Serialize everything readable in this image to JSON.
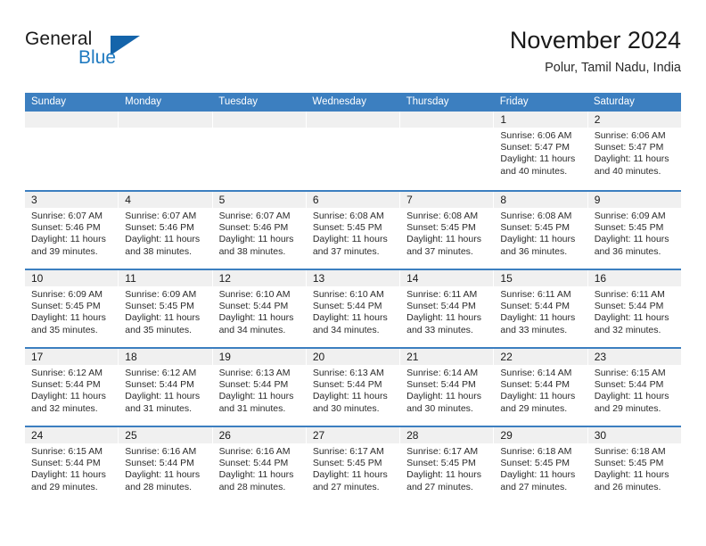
{
  "brand": {
    "general": "General",
    "blue": "Blue",
    "triangle_color": "#1464aa"
  },
  "header": {
    "title": "November 2024",
    "subtitle": "Polur, Tamil Nadu, India"
  },
  "theme": {
    "header_blue": "#3c7fc0",
    "daynum_gray": "#f0f0f0",
    "text": "#2b2b2b"
  },
  "weekdays": [
    "Sunday",
    "Monday",
    "Tuesday",
    "Wednesday",
    "Thursday",
    "Friday",
    "Saturday"
  ],
  "labels": {
    "sunrise_prefix": "Sunrise:",
    "sunset_prefix": "Sunset:",
    "daylight_prefix": "Daylight:"
  },
  "weeks": [
    [
      {
        "day": "",
        "empty": true
      },
      {
        "day": "",
        "empty": true
      },
      {
        "day": "",
        "empty": true
      },
      {
        "day": "",
        "empty": true
      },
      {
        "day": "",
        "empty": true
      },
      {
        "day": "1",
        "sunrise": "Sunrise: 6:06 AM",
        "sunset": "Sunset: 5:47 PM",
        "daylight1": "Daylight: 11 hours",
        "daylight2": "and 40 minutes."
      },
      {
        "day": "2",
        "sunrise": "Sunrise: 6:06 AM",
        "sunset": "Sunset: 5:47 PM",
        "daylight1": "Daylight: 11 hours",
        "daylight2": "and 40 minutes."
      }
    ],
    [
      {
        "day": "3",
        "sunrise": "Sunrise: 6:07 AM",
        "sunset": "Sunset: 5:46 PM",
        "daylight1": "Daylight: 11 hours",
        "daylight2": "and 39 minutes."
      },
      {
        "day": "4",
        "sunrise": "Sunrise: 6:07 AM",
        "sunset": "Sunset: 5:46 PM",
        "daylight1": "Daylight: 11 hours",
        "daylight2": "and 38 minutes."
      },
      {
        "day": "5",
        "sunrise": "Sunrise: 6:07 AM",
        "sunset": "Sunset: 5:46 PM",
        "daylight1": "Daylight: 11 hours",
        "daylight2": "and 38 minutes."
      },
      {
        "day": "6",
        "sunrise": "Sunrise: 6:08 AM",
        "sunset": "Sunset: 5:45 PM",
        "daylight1": "Daylight: 11 hours",
        "daylight2": "and 37 minutes."
      },
      {
        "day": "7",
        "sunrise": "Sunrise: 6:08 AM",
        "sunset": "Sunset: 5:45 PM",
        "daylight1": "Daylight: 11 hours",
        "daylight2": "and 37 minutes."
      },
      {
        "day": "8",
        "sunrise": "Sunrise: 6:08 AM",
        "sunset": "Sunset: 5:45 PM",
        "daylight1": "Daylight: 11 hours",
        "daylight2": "and 36 minutes."
      },
      {
        "day": "9",
        "sunrise": "Sunrise: 6:09 AM",
        "sunset": "Sunset: 5:45 PM",
        "daylight1": "Daylight: 11 hours",
        "daylight2": "and 36 minutes."
      }
    ],
    [
      {
        "day": "10",
        "sunrise": "Sunrise: 6:09 AM",
        "sunset": "Sunset: 5:45 PM",
        "daylight1": "Daylight: 11 hours",
        "daylight2": "and 35 minutes."
      },
      {
        "day": "11",
        "sunrise": "Sunrise: 6:09 AM",
        "sunset": "Sunset: 5:45 PM",
        "daylight1": "Daylight: 11 hours",
        "daylight2": "and 35 minutes."
      },
      {
        "day": "12",
        "sunrise": "Sunrise: 6:10 AM",
        "sunset": "Sunset: 5:44 PM",
        "daylight1": "Daylight: 11 hours",
        "daylight2": "and 34 minutes."
      },
      {
        "day": "13",
        "sunrise": "Sunrise: 6:10 AM",
        "sunset": "Sunset: 5:44 PM",
        "daylight1": "Daylight: 11 hours",
        "daylight2": "and 34 minutes."
      },
      {
        "day": "14",
        "sunrise": "Sunrise: 6:11 AM",
        "sunset": "Sunset: 5:44 PM",
        "daylight1": "Daylight: 11 hours",
        "daylight2": "and 33 minutes."
      },
      {
        "day": "15",
        "sunrise": "Sunrise: 6:11 AM",
        "sunset": "Sunset: 5:44 PM",
        "daylight1": "Daylight: 11 hours",
        "daylight2": "and 33 minutes."
      },
      {
        "day": "16",
        "sunrise": "Sunrise: 6:11 AM",
        "sunset": "Sunset: 5:44 PM",
        "daylight1": "Daylight: 11 hours",
        "daylight2": "and 32 minutes."
      }
    ],
    [
      {
        "day": "17",
        "sunrise": "Sunrise: 6:12 AM",
        "sunset": "Sunset: 5:44 PM",
        "daylight1": "Daylight: 11 hours",
        "daylight2": "and 32 minutes."
      },
      {
        "day": "18",
        "sunrise": "Sunrise: 6:12 AM",
        "sunset": "Sunset: 5:44 PM",
        "daylight1": "Daylight: 11 hours",
        "daylight2": "and 31 minutes."
      },
      {
        "day": "19",
        "sunrise": "Sunrise: 6:13 AM",
        "sunset": "Sunset: 5:44 PM",
        "daylight1": "Daylight: 11 hours",
        "daylight2": "and 31 minutes."
      },
      {
        "day": "20",
        "sunrise": "Sunrise: 6:13 AM",
        "sunset": "Sunset: 5:44 PM",
        "daylight1": "Daylight: 11 hours",
        "daylight2": "and 30 minutes."
      },
      {
        "day": "21",
        "sunrise": "Sunrise: 6:14 AM",
        "sunset": "Sunset: 5:44 PM",
        "daylight1": "Daylight: 11 hours",
        "daylight2": "and 30 minutes."
      },
      {
        "day": "22",
        "sunrise": "Sunrise: 6:14 AM",
        "sunset": "Sunset: 5:44 PM",
        "daylight1": "Daylight: 11 hours",
        "daylight2": "and 29 minutes."
      },
      {
        "day": "23",
        "sunrise": "Sunrise: 6:15 AM",
        "sunset": "Sunset: 5:44 PM",
        "daylight1": "Daylight: 11 hours",
        "daylight2": "and 29 minutes."
      }
    ],
    [
      {
        "day": "24",
        "sunrise": "Sunrise: 6:15 AM",
        "sunset": "Sunset: 5:44 PM",
        "daylight1": "Daylight: 11 hours",
        "daylight2": "and 29 minutes."
      },
      {
        "day": "25",
        "sunrise": "Sunrise: 6:16 AM",
        "sunset": "Sunset: 5:44 PM",
        "daylight1": "Daylight: 11 hours",
        "daylight2": "and 28 minutes."
      },
      {
        "day": "26",
        "sunrise": "Sunrise: 6:16 AM",
        "sunset": "Sunset: 5:44 PM",
        "daylight1": "Daylight: 11 hours",
        "daylight2": "and 28 minutes."
      },
      {
        "day": "27",
        "sunrise": "Sunrise: 6:17 AM",
        "sunset": "Sunset: 5:45 PM",
        "daylight1": "Daylight: 11 hours",
        "daylight2": "and 27 minutes."
      },
      {
        "day": "28",
        "sunrise": "Sunrise: 6:17 AM",
        "sunset": "Sunset: 5:45 PM",
        "daylight1": "Daylight: 11 hours",
        "daylight2": "and 27 minutes."
      },
      {
        "day": "29",
        "sunrise": "Sunrise: 6:18 AM",
        "sunset": "Sunset: 5:45 PM",
        "daylight1": "Daylight: 11 hours",
        "daylight2": "and 27 minutes."
      },
      {
        "day": "30",
        "sunrise": "Sunrise: 6:18 AM",
        "sunset": "Sunset: 5:45 PM",
        "daylight1": "Daylight: 11 hours",
        "daylight2": "and 26 minutes."
      }
    ]
  ]
}
